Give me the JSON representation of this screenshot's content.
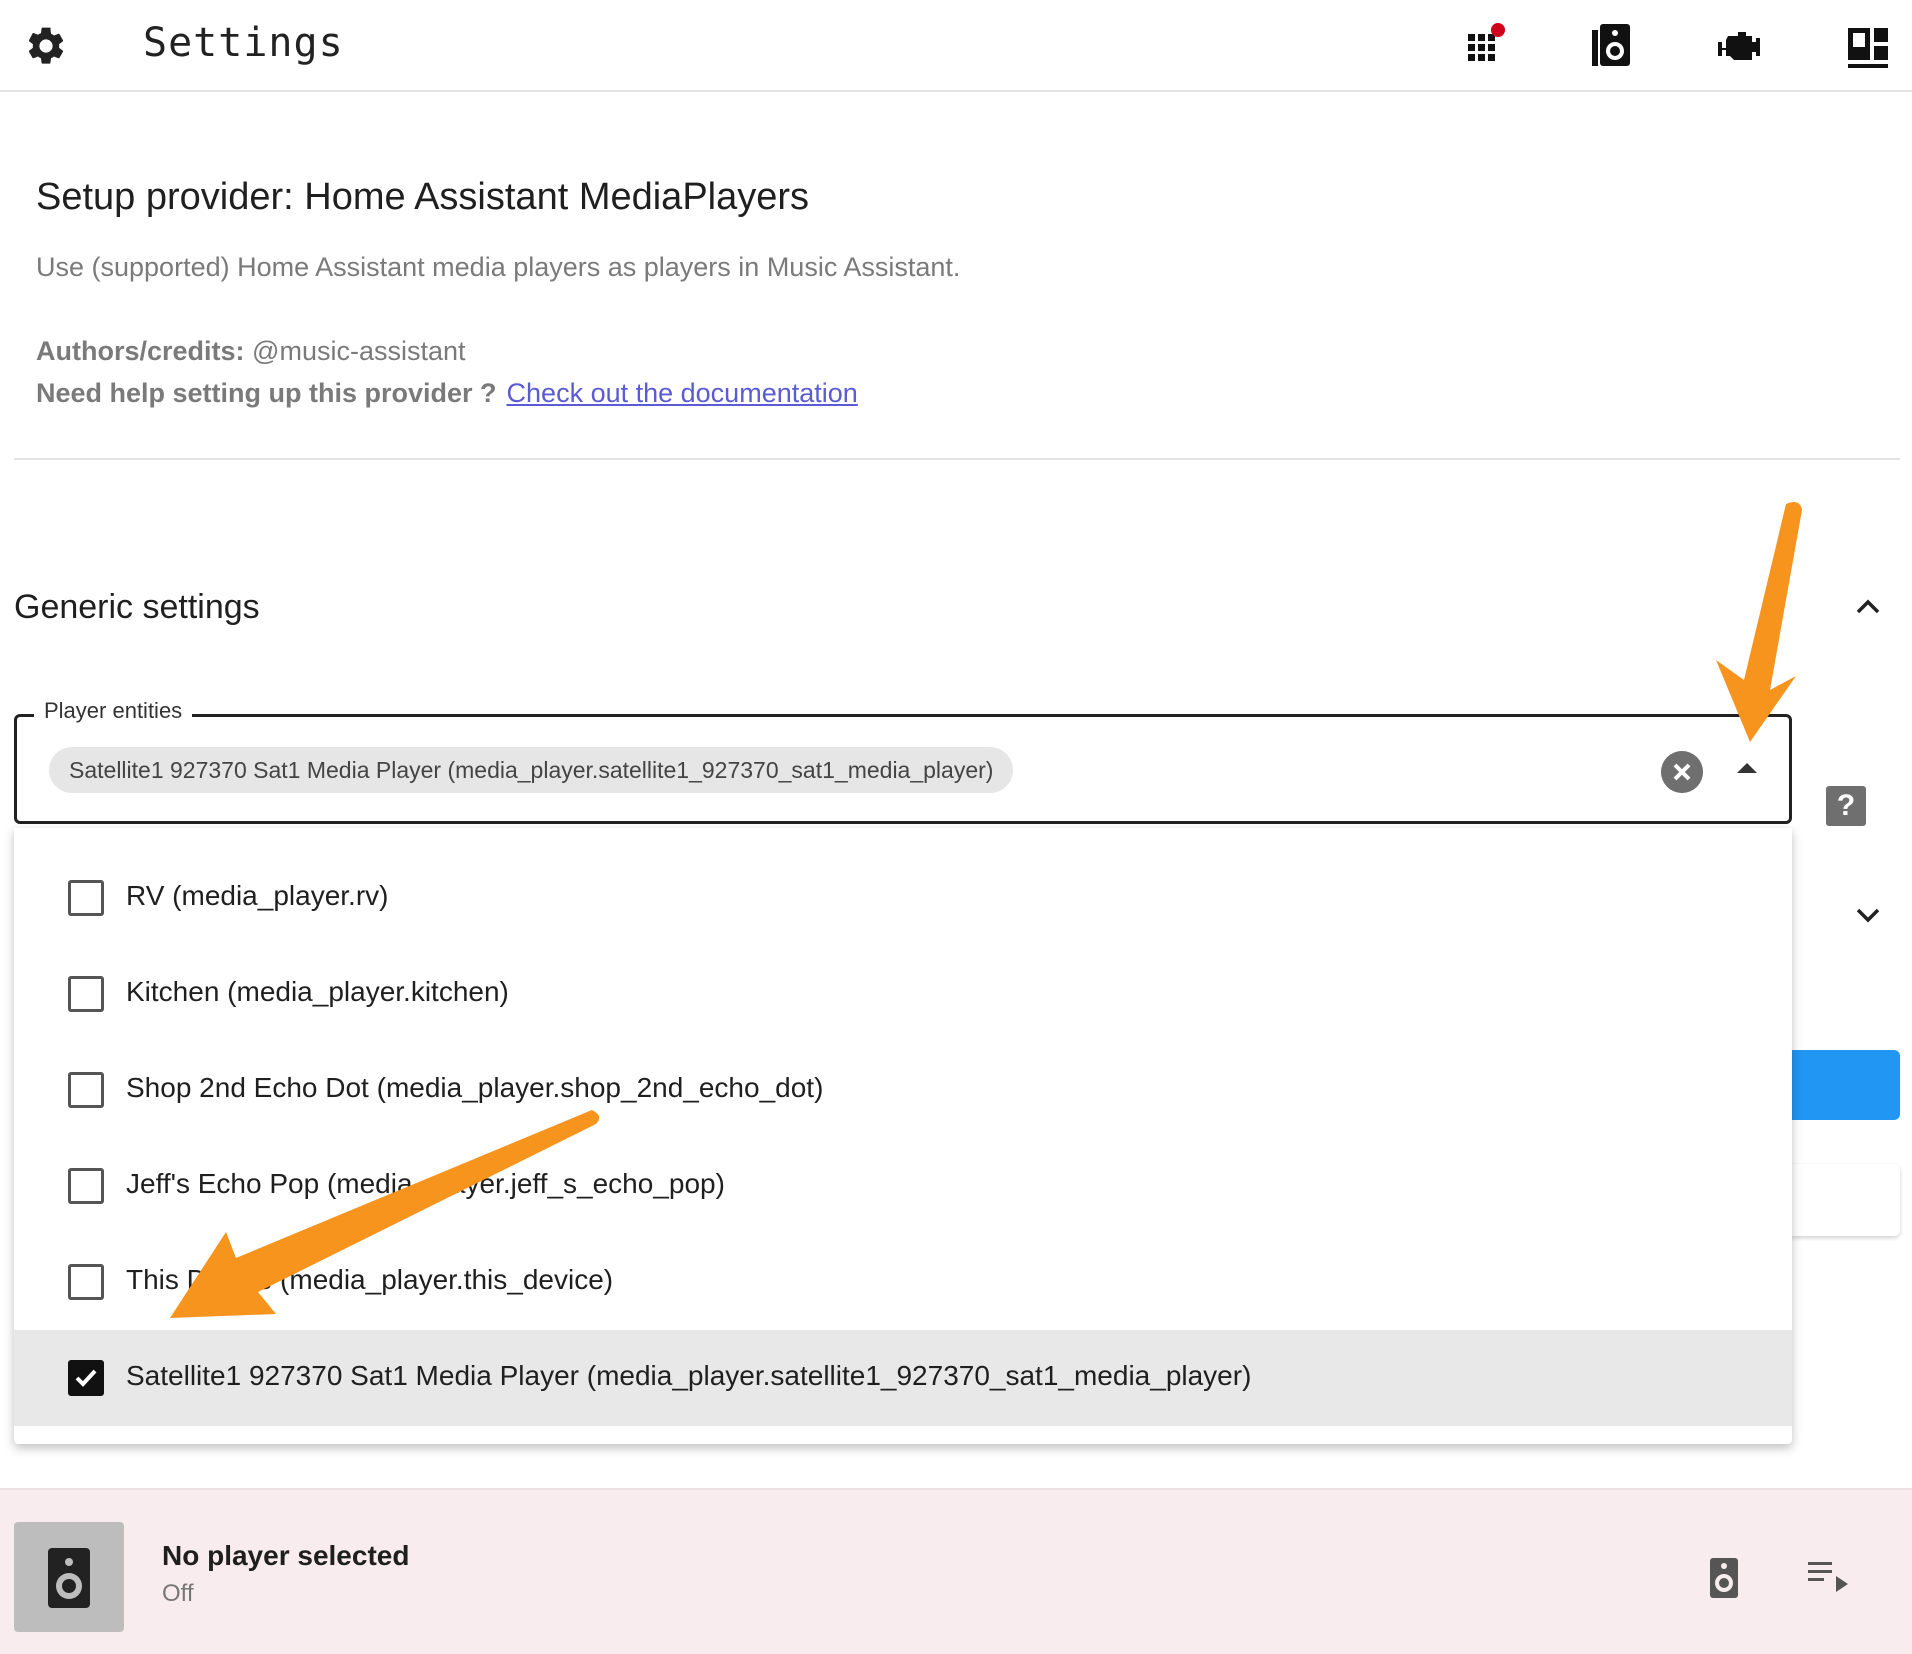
{
  "topbar": {
    "title": "Settings",
    "icons": [
      "gear-icon",
      "grid-icon",
      "speaker-icon",
      "engine-icon",
      "dashboard-icon"
    ],
    "badge_color": "#d0021b"
  },
  "provider": {
    "title": "Setup provider: Home Assistant MediaPlayers",
    "description": "Use (supported) Home Assistant media players as players in Music Assistant.",
    "credits_label": "Authors/credits:",
    "credits_value": "@music-assistant",
    "help_label": "Need help setting up this provider ?",
    "help_link": "Check out the documentation"
  },
  "generic_settings": {
    "title": "Generic settings",
    "field_label": "Player entities",
    "selected_chip": "Satellite1 927370 Sat1 Media Player (media_player.satellite1_927370_sat1_media_player)",
    "help_glyph": "?",
    "options": [
      {
        "label": "RV (media_player.rv)",
        "checked": false
      },
      {
        "label": "Kitchen (media_player.kitchen)",
        "checked": false
      },
      {
        "label": "Shop 2nd Echo Dot (media_player.shop_2nd_echo_dot)",
        "checked": false
      },
      {
        "label": "Jeff's Echo Pop (media_player.jeff_s_echo_pop)",
        "checked": false
      },
      {
        "label": "This Device (media_player.this_device)",
        "checked": false
      },
      {
        "label": "Satellite1 927370 Sat1 Media Player (media_player.satellite1_927370_sat1_media_player)",
        "checked": true
      }
    ]
  },
  "player_bar": {
    "name": "No player selected",
    "status": "Off"
  },
  "colors": {
    "accent_blue": "#2196f3",
    "annotation_orange": "#f7941d",
    "link": "#5b5bd6",
    "player_bar_bg": "#f9ecee"
  }
}
